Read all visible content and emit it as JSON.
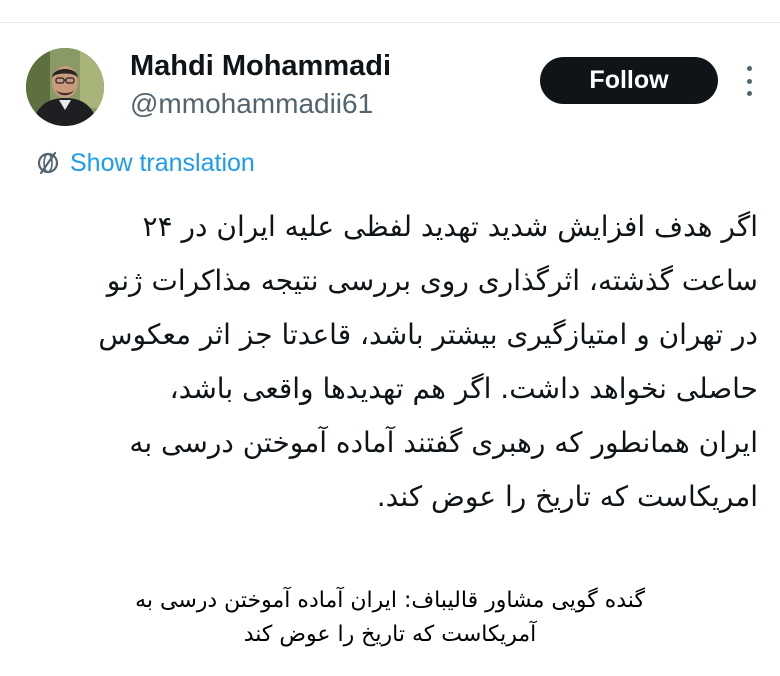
{
  "author": {
    "display_name": "Mahdi Mohammadi",
    "handle": "@mmohammadii61"
  },
  "actions": {
    "follow_label": "Follow",
    "more_icon": "more-vertical-icon"
  },
  "translation": {
    "icon": "globe-icon",
    "label": "Show translation"
  },
  "tweet": {
    "lines": [
      "اگر هدف افزایش شدید تهدید لفظی علیه ایران در ۲۴",
      "ساعت گذشته، اثرگذاری روی بررسی نتیجه مذاکرات ژنو",
      "در تهران و امتیازگیری بیشتر باشد، قاعدتا جز اثر معکوس",
      "حاصلی نخواهد داشت. اگر هم تهدیدها واقعی باشد،",
      "ایران همانطور که رهبری گفتند آماده آموختن درسی به",
      "امریکاست که تاریخ را عوض کند."
    ]
  },
  "caption": {
    "lines": [
      "گنده گویی مشاور قالیباف: ایران آماده آموختن درسی به",
      "آمریکاست که تاریخ را عوض کند"
    ]
  },
  "colors": {
    "follow_bg": "#0f1419",
    "link": "#1d9bf0",
    "secondary_text": "#536471"
  }
}
